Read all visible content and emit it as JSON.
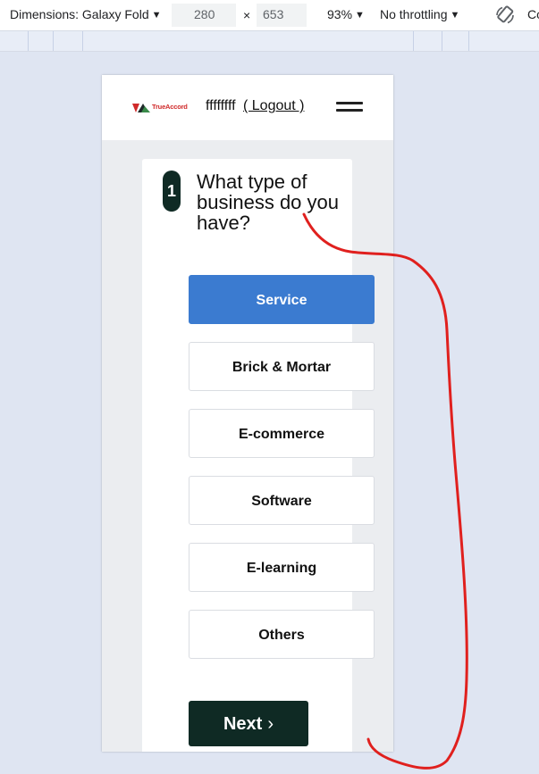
{
  "devtools": {
    "dimensions_label": "Dimensions: Galaxy Fold",
    "width_value": "280",
    "times_sign": "×",
    "height_value": "653",
    "zoom": "93%",
    "throttling": "No throttling",
    "cut_label": "Co",
    "rotate_icon": "rotate-icon"
  },
  "header": {
    "logo_text": "TrueAccord",
    "username": "ffffffff",
    "logout_label": "( Logout )"
  },
  "step": {
    "number": "1",
    "question": "What type of business do you have?"
  },
  "options": [
    {
      "label": "Service",
      "selected": true
    },
    {
      "label": "Brick & Mortar",
      "selected": false
    },
    {
      "label": "E-commerce",
      "selected": false
    },
    {
      "label": "Software",
      "selected": false
    },
    {
      "label": "E-learning",
      "selected": false
    },
    {
      "label": "Others",
      "selected": false
    }
  ],
  "next_label": "Next",
  "next_chevron": "›",
  "colors": {
    "selected": "#3b7bd0",
    "dark": "#0f2a24",
    "annotation": "#e0201e"
  }
}
